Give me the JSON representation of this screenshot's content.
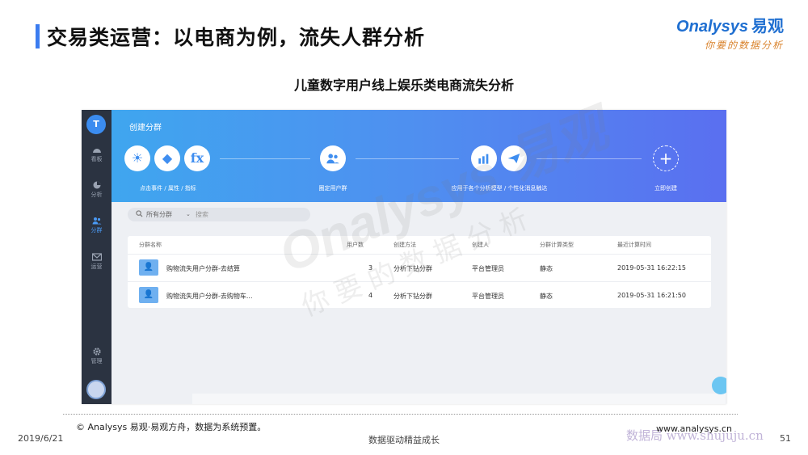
{
  "page": {
    "title": "交易类运营：以电商为例，流失人群分析",
    "subtitle": "儿童数字用户线上娱乐类电商流失分析",
    "logo_brand": "nalysys",
    "logo_brand_cn": "易观",
    "logo_slogan": "你要的数据分析",
    "accent_color": "#3b7cf0"
  },
  "sidebar": {
    "avatar_letter": "T",
    "items": [
      {
        "label": "看板",
        "icon": "gauge-icon"
      },
      {
        "label": "分析",
        "icon": "pie-chart-icon"
      },
      {
        "label": "分群",
        "icon": "users-icon",
        "active": true
      },
      {
        "label": "运营",
        "icon": "mail-icon"
      },
      {
        "label": "管理",
        "icon": "gear-icon"
      }
    ]
  },
  "banner": {
    "title": "创建分群",
    "step1_icons": [
      "☀",
      "◆",
      "fx"
    ],
    "step1_label": "点击事件 / 属性 / 指标",
    "step2_label": "圈定用户群",
    "step3_label": "应用于各个分析模型 / 个性化消息触达",
    "step4_label": "立即创建",
    "step4_icon": "+"
  },
  "filter": {
    "scope": "所有分群",
    "search_placeholder": "搜索"
  },
  "table": {
    "columns": [
      "分群名称",
      "用户数",
      "创建方法",
      "创建人",
      "分群计算类型",
      "最近计算时间"
    ],
    "rows": [
      {
        "name": "购物流失用户分群-去结算",
        "users": "3",
        "method": "分析下钻分群",
        "creator": "平台管理员",
        "type": "静态",
        "time": "2019-05-31 16:22:15"
      },
      {
        "name": "购物流失用户分群-去购物车...",
        "users": "4",
        "method": "分析下钻分群",
        "creator": "平台管理员",
        "type": "静态",
        "time": "2019-05-31 16:21:50"
      }
    ]
  },
  "watermark": {
    "brand": "Onalysys 易观",
    "slogan": "你要的数据分析"
  },
  "footer": {
    "copyright": "© Analysys 易观·易观方舟，数据为系统预置。",
    "date": "2019/6/21",
    "motto": "数据驱动精益成长",
    "url": "www.analysys.cn",
    "page_number": "51",
    "site_watermark": "数据局 www.shujuju.cn"
  }
}
